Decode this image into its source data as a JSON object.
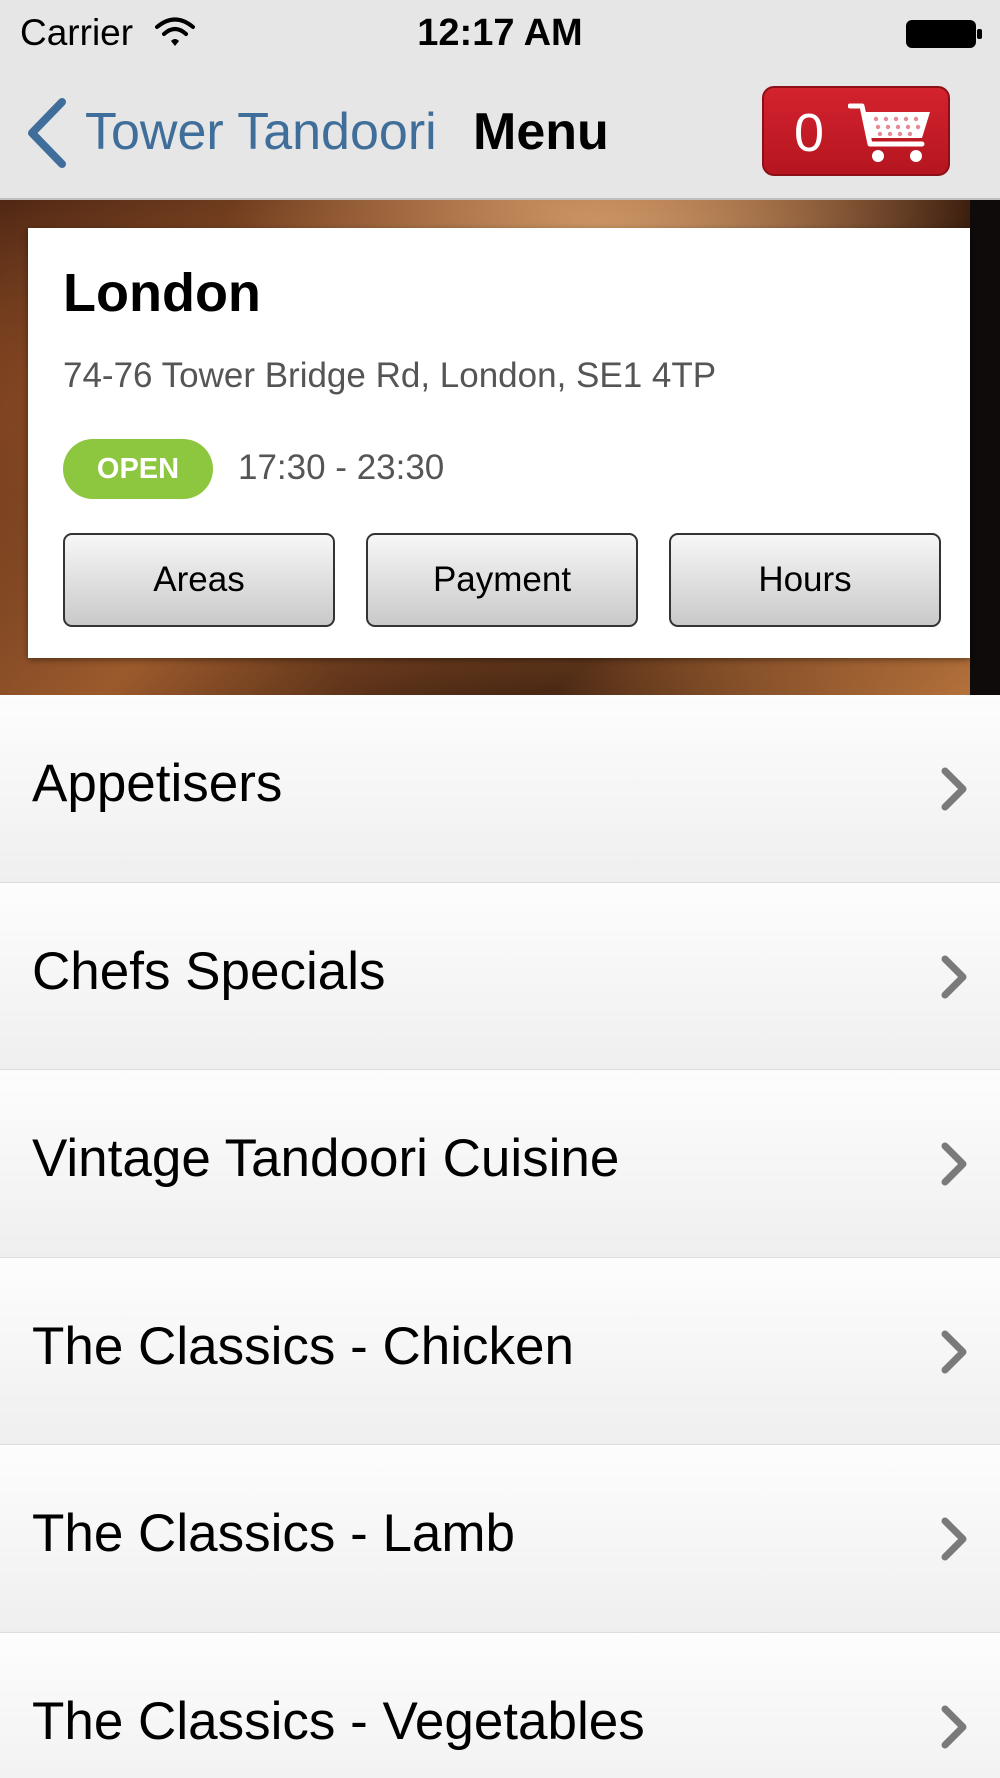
{
  "status_bar": {
    "carrier": "Carrier",
    "time": "12:17 AM",
    "icons": [
      "wifi-icon",
      "battery-icon"
    ]
  },
  "nav": {
    "back_label": "Tower Tandoori",
    "title": "Menu",
    "cart_count": "0",
    "cart_icon": "shopping-cart-icon",
    "cart_color": "#c41e2a",
    "accent_color": "#3f6e9a"
  },
  "location": {
    "city": "London",
    "address": "74-76 Tower Bridge Rd, London, SE1 4TP",
    "status": "OPEN",
    "status_color": "#8dc63f",
    "hours": "17:30 - 23:30",
    "buttons": [
      "Areas",
      "Payment",
      "Hours"
    ]
  },
  "menu": {
    "categories": [
      "Appetisers",
      "Chefs Specials",
      "Vintage Tandoori Cuisine",
      "The Classics - Chicken",
      "The Classics - Lamb",
      "The Classics - Vegetables"
    ]
  }
}
